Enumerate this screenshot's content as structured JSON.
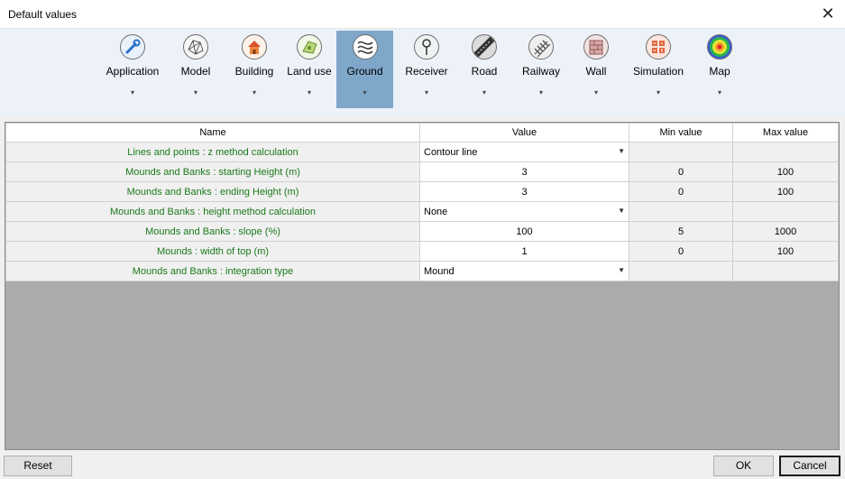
{
  "window": {
    "title": "Default values",
    "close_glyph": "✕"
  },
  "ribbon": {
    "items": [
      {
        "label": "Application",
        "icon": "wrench-icon",
        "active": false
      },
      {
        "label": "Model",
        "icon": "terrain-mesh-icon",
        "active": false
      },
      {
        "label": "Building",
        "icon": "house-icon",
        "active": false
      },
      {
        "label": "Land use",
        "icon": "land-use-icon",
        "active": false
      },
      {
        "label": "Ground",
        "icon": "ground-contour-icon",
        "active": true
      },
      {
        "label": "Receiver",
        "icon": "receiver-pin-icon",
        "active": false
      },
      {
        "label": "Road",
        "icon": "road-icon",
        "active": false
      },
      {
        "label": "Railway",
        "icon": "railway-icon",
        "active": false
      },
      {
        "label": "Wall",
        "icon": "wall-icon",
        "active": false
      },
      {
        "label": "Simulation",
        "icon": "calculator-icon",
        "active": false
      },
      {
        "label": "Map",
        "icon": "color-map-icon",
        "active": false
      }
    ],
    "caret": "▾",
    "active_color": "#7fa7c9"
  },
  "table": {
    "columns": [
      "Name",
      "Value",
      "Min value",
      "Max value"
    ],
    "rows": [
      {
        "name": "Lines and points : z method calculation",
        "value": "Contour line",
        "type": "combo",
        "min": "",
        "max": ""
      },
      {
        "name": "Mounds and Banks : starting Height (m)",
        "value": "3",
        "type": "number",
        "min": "0",
        "max": "100"
      },
      {
        "name": "Mounds and Banks : ending Height (m)",
        "value": "3",
        "type": "number",
        "min": "0",
        "max": "100"
      },
      {
        "name": "Mounds and Banks : height method calculation",
        "value": "None",
        "type": "combo",
        "min": "",
        "max": ""
      },
      {
        "name": "Mounds and Banks : slope (%)",
        "value": "100",
        "type": "number",
        "min": "5",
        "max": "1000"
      },
      {
        "name": "Mounds : width of top (m)",
        "value": "1",
        "type": "number",
        "min": "0",
        "max": "100"
      },
      {
        "name": "Mounds and Banks : integration type",
        "value": "Mound",
        "type": "combo",
        "min": "",
        "max": ""
      }
    ],
    "name_color": "#1a7a1a"
  },
  "buttons": {
    "reset": "Reset",
    "ok": "OK",
    "cancel": "Cancel"
  }
}
